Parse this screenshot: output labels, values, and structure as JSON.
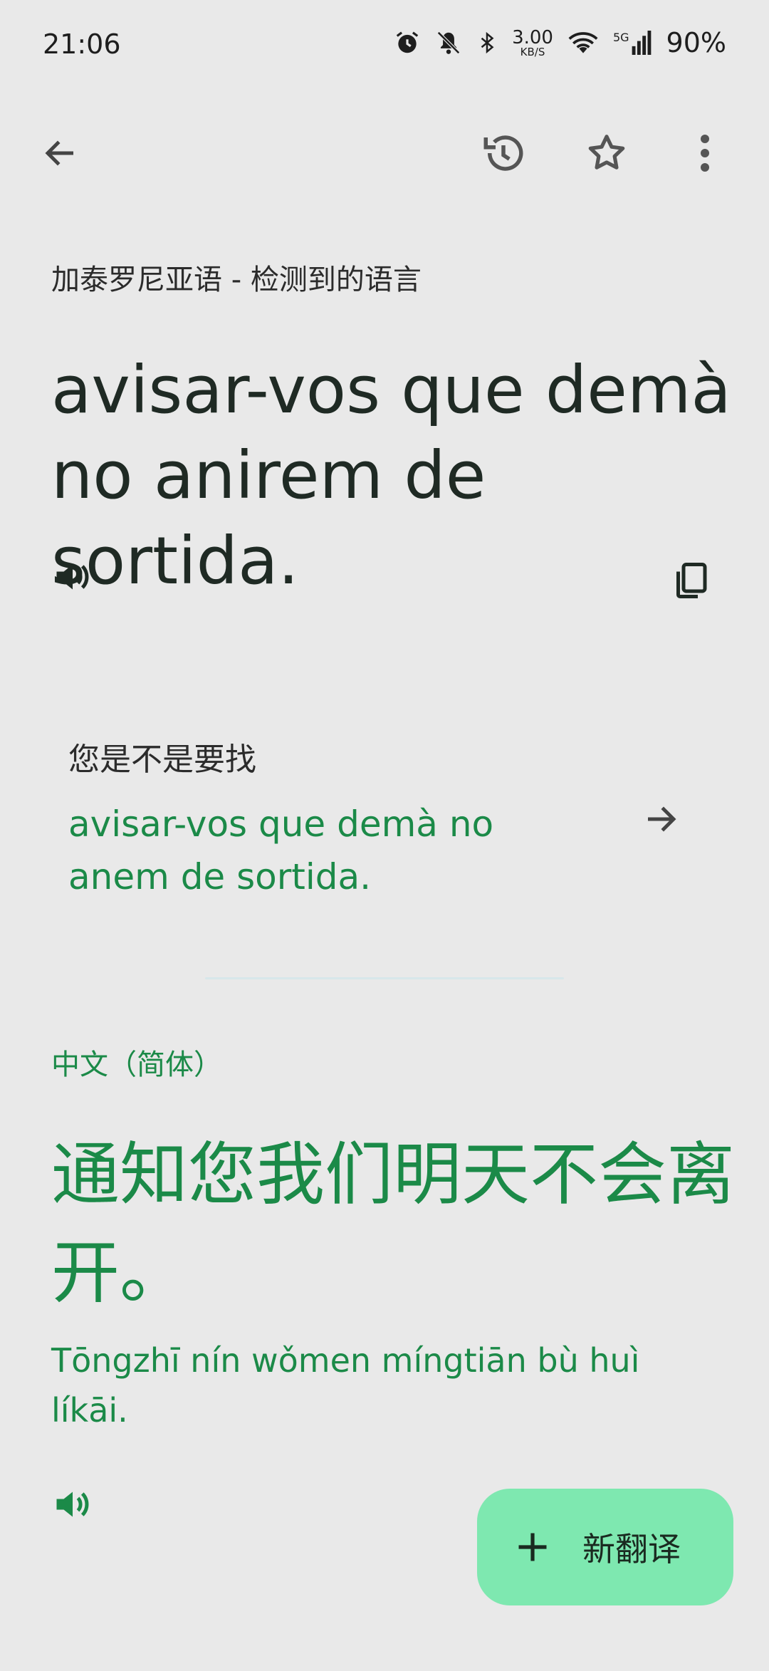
{
  "status_bar": {
    "time": "21:06",
    "net_speed_value": "3.00",
    "net_speed_unit": "KB/S",
    "network": "5G",
    "battery": "90%"
  },
  "toolbar": {
    "back_icon": "arrow-left",
    "history_icon": "history",
    "favorite_icon": "star-outline",
    "more_icon": "more-vert"
  },
  "source": {
    "language_label": "加泰罗尼亚语 - 检测到的语言",
    "text": "avisar-vos que demà no anirem de sortida."
  },
  "did_you_mean": {
    "label": "您是不是要找",
    "suggestion": "avisar-vos que demà no anem de sortida."
  },
  "target": {
    "language_label": "中文（简体）",
    "text": "通知您我们明天不会离开。",
    "pinyin": "Tōngzhī nín wǒmen míngtiān bù huì líkāi."
  },
  "fab": {
    "label": "新翻译",
    "icon": "plus"
  },
  "colors": {
    "background": "#e9e9e9",
    "accent_green": "#1b8a48",
    "fab_background": "#7ee8b0"
  }
}
